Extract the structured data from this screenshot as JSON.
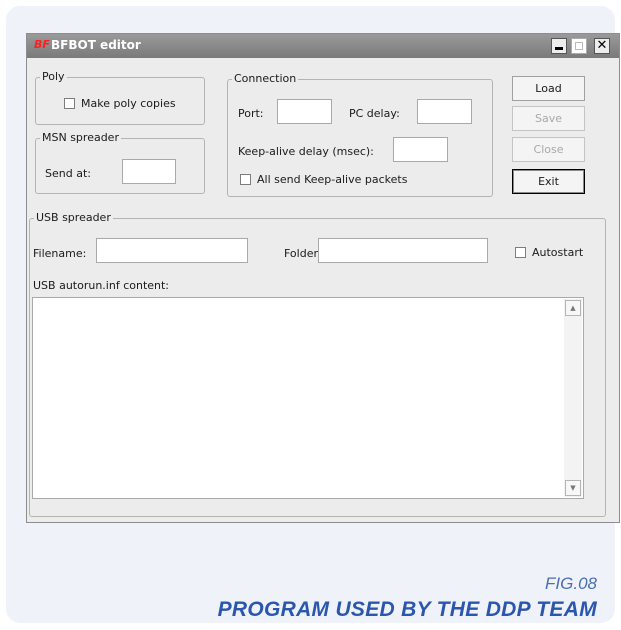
{
  "window": {
    "title": "BFBOT editor",
    "app_logo_text": "BF",
    "minimize_glyph": "_",
    "close_glyph": "✕"
  },
  "poly": {
    "legend": "Poly",
    "make_copies_label": "Make poly copies",
    "make_copies_checked": false
  },
  "msn": {
    "legend": "MSN spreader",
    "send_at_label": "Send at:",
    "send_at_value": ""
  },
  "connection": {
    "legend": "Connection",
    "port_label": "Port:",
    "port_value": "",
    "pc_delay_label": "PC delay:",
    "pc_delay_value": "",
    "keepalive_delay_label": "Keep-alive delay (msec):",
    "keepalive_delay_value": "",
    "all_send_label": "All send Keep-alive packets",
    "all_send_checked": false
  },
  "buttons": {
    "load": "Load",
    "save": "Save",
    "close": "Close",
    "exit": "Exit"
  },
  "usb": {
    "legend": "USB spreader",
    "filename_label": "Filename:",
    "filename_value": "",
    "folder_label": "Folder:",
    "folder_value": "",
    "autostart_label": "Autostart",
    "autostart_checked": false,
    "autorun_label": "USB autorun.inf content:",
    "autorun_value": ""
  },
  "caption": {
    "fig": "FIG.08",
    "title": "PROGRAM USED BY THE DDP TEAM"
  },
  "colors": {
    "caption_blue": "#2a57ad",
    "titlebar_grey": "#8a8a8a",
    "logo_red": "#ff2020"
  }
}
